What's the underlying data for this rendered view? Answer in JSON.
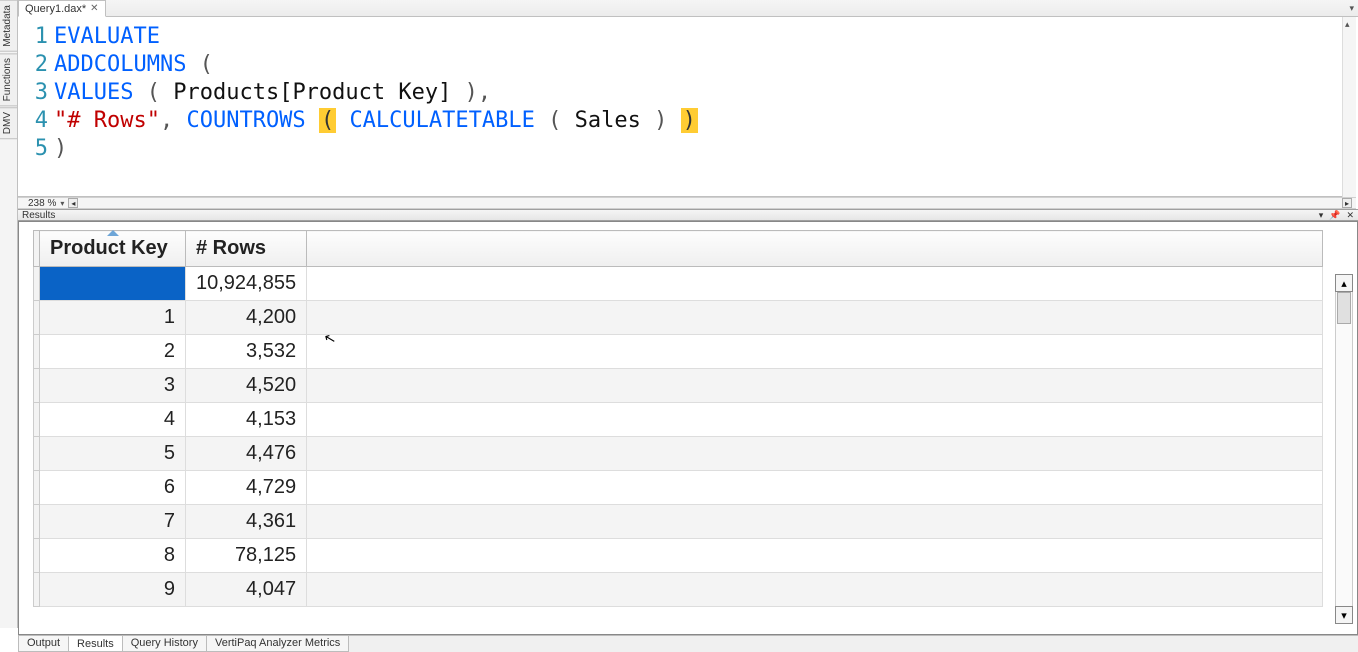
{
  "file_tab": {
    "title": "Query1.dax*"
  },
  "left_rails": [
    "Metadata",
    "Functions",
    "DMV"
  ],
  "zoom": {
    "label": "238 %"
  },
  "code": {
    "lines": [
      {
        "n": "1",
        "segments": [
          {
            "cls": "kw",
            "t": "EVALUATE"
          }
        ]
      },
      {
        "n": "2",
        "segments": [
          {
            "cls": "kw",
            "t": "ADDCOLUMNS"
          },
          {
            "cls": "punct",
            "t": " ("
          }
        ]
      },
      {
        "n": "3",
        "segments": [
          {
            "cls": "",
            "t": "    "
          },
          {
            "cls": "kw",
            "t": "VALUES"
          },
          {
            "cls": "punct",
            "t": " ( "
          },
          {
            "cls": "ident",
            "t": "Products[Product Key]"
          },
          {
            "cls": "punct",
            "t": " ),"
          }
        ]
      },
      {
        "n": "4",
        "segments": [
          {
            "cls": "",
            "t": "    "
          },
          {
            "cls": "str",
            "t": "\"# Rows\""
          },
          {
            "cls": "punct",
            "t": ", "
          },
          {
            "cls": "kw",
            "t": "COUNTROWS"
          },
          {
            "cls": "",
            "t": " "
          },
          {
            "cls": "hlpar",
            "t": "("
          },
          {
            "cls": "",
            "t": " "
          },
          {
            "cls": "kw",
            "t": "CALCULATETABLE"
          },
          {
            "cls": "punct",
            "t": " ( "
          },
          {
            "cls": "ident",
            "t": "Sales"
          },
          {
            "cls": "punct",
            "t": " ) "
          },
          {
            "cls": "hlpar",
            "t": ")"
          }
        ]
      },
      {
        "n": "5",
        "segments": [
          {
            "cls": "punct",
            "t": ")"
          }
        ]
      }
    ]
  },
  "results": {
    "panel_label": "Results",
    "columns": [
      "Product Key",
      "# Rows"
    ],
    "rows": [
      {
        "pk": "",
        "rows": "10,924,855",
        "selected": true
      },
      {
        "pk": "1",
        "rows": "4,200"
      },
      {
        "pk": "2",
        "rows": "3,532"
      },
      {
        "pk": "3",
        "rows": "4,520"
      },
      {
        "pk": "4",
        "rows": "4,153"
      },
      {
        "pk": "5",
        "rows": "4,476"
      },
      {
        "pk": "6",
        "rows": "4,729"
      },
      {
        "pk": "7",
        "rows": "4,361"
      },
      {
        "pk": "8",
        "rows": "78,125"
      },
      {
        "pk": "9",
        "rows": "4,047"
      }
    ]
  },
  "bottom_tabs": {
    "items": [
      "Output",
      "Results",
      "Query History",
      "VertiPaq Analyzer Metrics"
    ],
    "active": "Results"
  }
}
